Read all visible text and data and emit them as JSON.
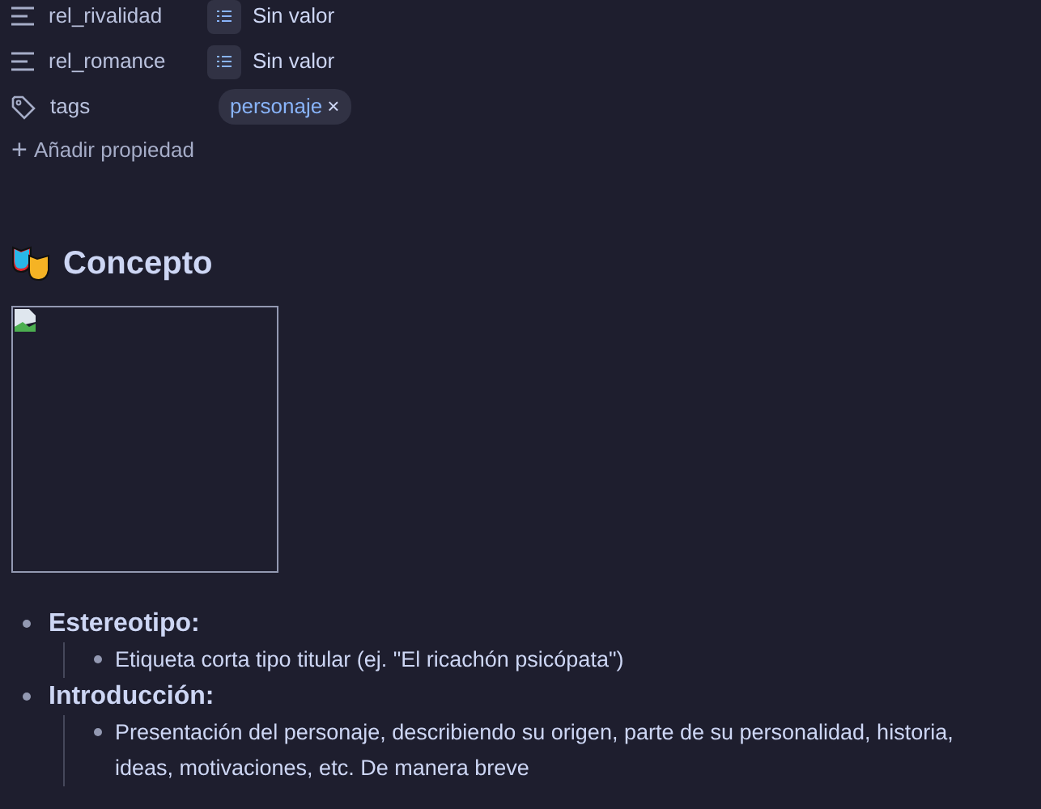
{
  "properties": [
    {
      "kind": "list",
      "name": "rel_rivalidad",
      "value": "Sin valor"
    },
    {
      "kind": "list",
      "name": "rel_romance",
      "value": "Sin valor"
    },
    {
      "kind": "tags",
      "name": "tags",
      "tags": [
        {
          "label": "personaje",
          "remove": "×"
        }
      ]
    }
  ],
  "add_property": {
    "icon": "+",
    "label": "Añadir propiedad"
  },
  "heading": {
    "text": "Concepto"
  },
  "image": {
    "kind": "broken-image"
  },
  "outline": [
    {
      "text": "Estereotipo:",
      "children": [
        {
          "text": "Etiqueta corta tipo titular (ej. \"El ricachón psicópata\")"
        }
      ]
    },
    {
      "text": "Introducción:",
      "children": [
        {
          "text": "Presentación del personaje, describiendo su origen, parte de su personalidad, historia, ideas, motivaciones, etc. De manera breve"
        }
      ]
    }
  ]
}
